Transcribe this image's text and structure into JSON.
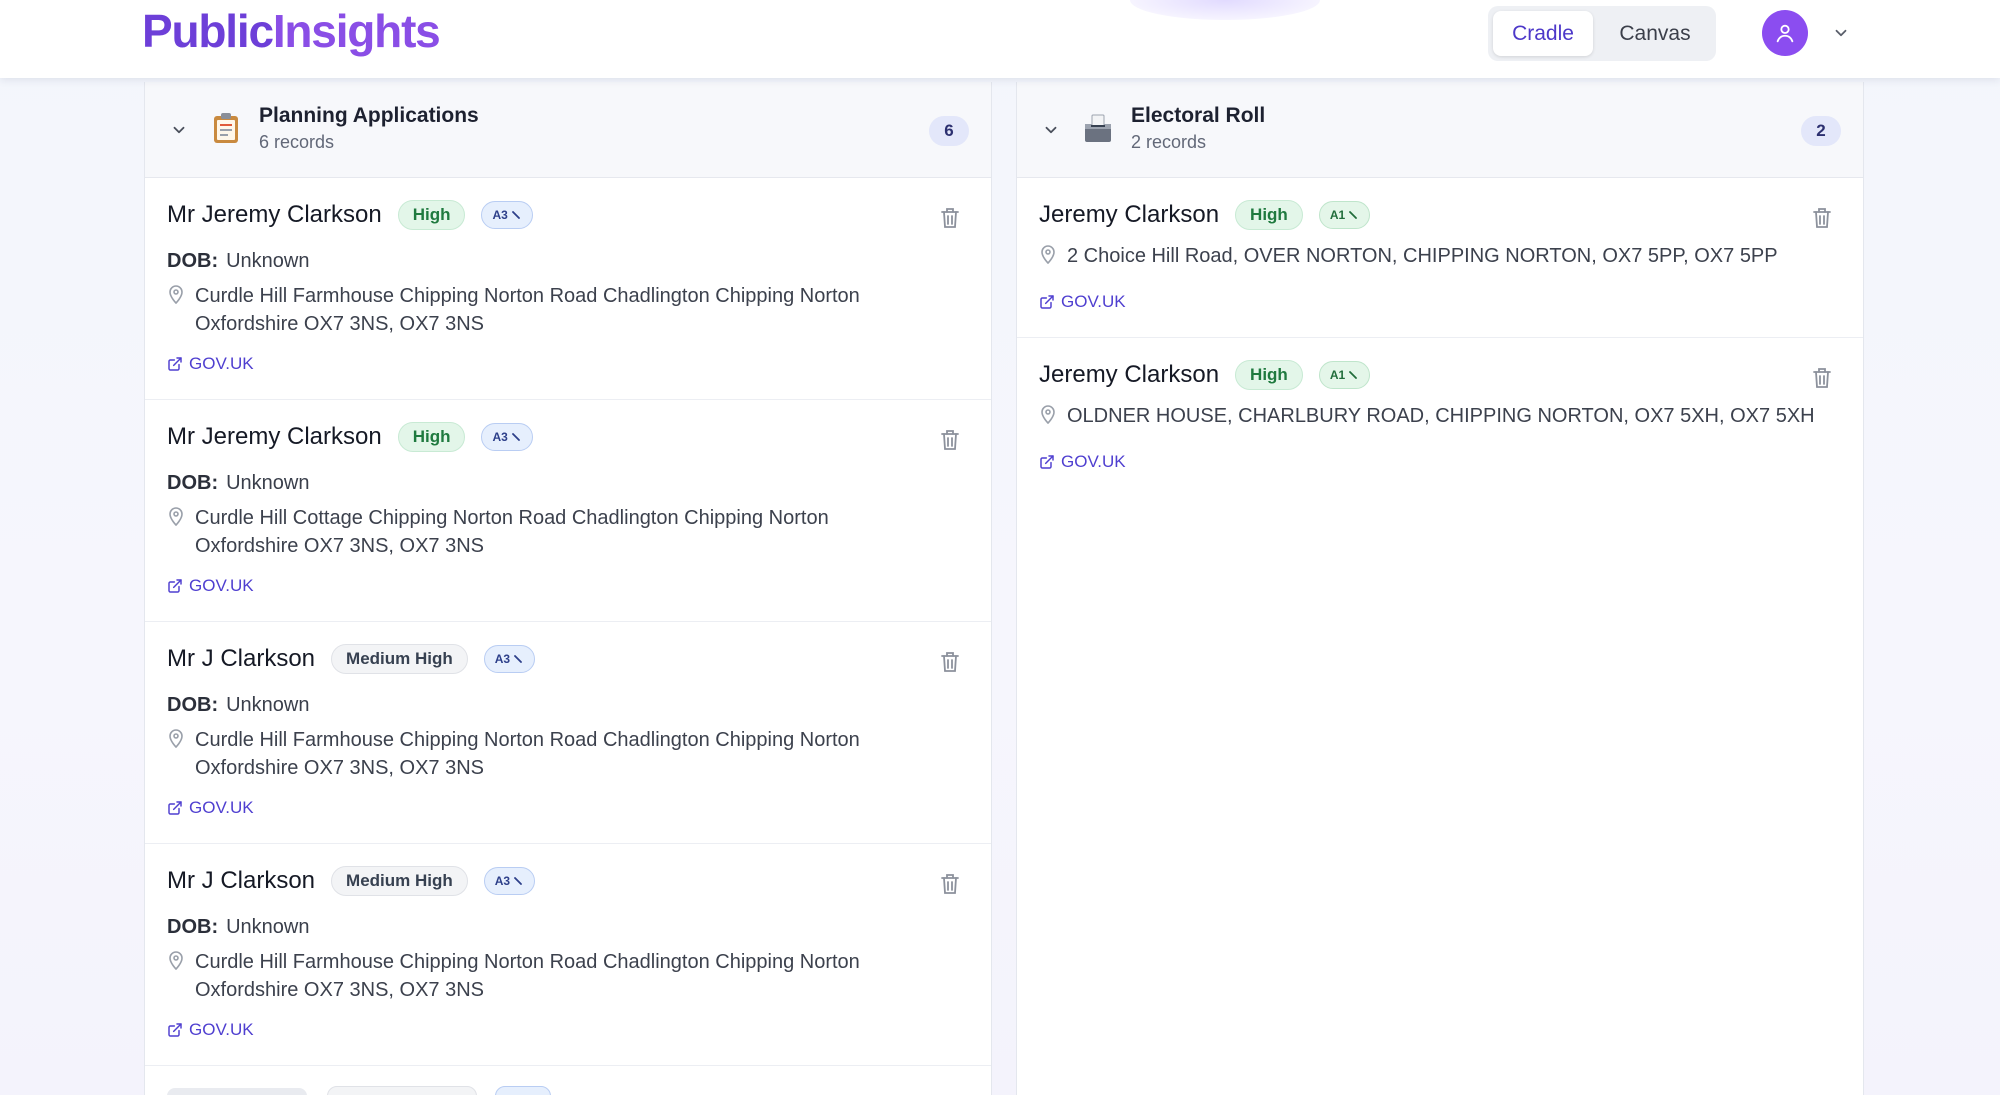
{
  "header": {
    "logo_part1": "Public",
    "logo_part2": "Insights",
    "views": [
      {
        "label": "Cradle",
        "active": true
      },
      {
        "label": "Canvas",
        "active": false
      }
    ],
    "avatar_icon": "user-icon",
    "menu_icon": "chevron-down-icon"
  },
  "colors": {
    "brand": "#6d3fd8",
    "accent": "#4f3fd0",
    "high_badge": "#1f7a3f"
  },
  "left_panel": {
    "title": "Planning Applications",
    "subtitle": "6 records",
    "count": "6",
    "icon": "clipboard-icon",
    "records": [
      {
        "name": "Mr Jeremy Clarkson",
        "confidence": "High",
        "tag": "A3",
        "dob_label": "DOB:",
        "dob": "Unknown",
        "address": "Curdle Hill Farmhouse Chipping Norton Road Chadlington Chipping Norton Oxfordshire OX7 3NS, OX7 3NS",
        "link": "GOV.UK"
      },
      {
        "name": "Mr Jeremy Clarkson",
        "confidence": "High",
        "tag": "A3",
        "dob_label": "DOB:",
        "dob": "Unknown",
        "address": "Curdle Hill Cottage Chipping Norton Road Chadlington Chipping Norton Oxfordshire OX7 3NS, OX7 3NS",
        "link": "GOV.UK"
      },
      {
        "name": "Mr J Clarkson",
        "confidence": "Medium High",
        "tag": "A3",
        "dob_label": "DOB:",
        "dob": "Unknown",
        "address": "Curdle Hill Farmhouse Chipping Norton Road Chadlington Chipping Norton Oxfordshire OX7 3NS, OX7 3NS",
        "link": "GOV.UK"
      },
      {
        "name": "Mr J Clarkson",
        "confidence": "Medium High",
        "tag": "A3",
        "dob_label": "DOB:",
        "dob": "Unknown",
        "address": "Curdle Hill Farmhouse Chipping Norton Road Chadlington Chipping Norton Oxfordshire OX7 3NS, OX7 3NS",
        "link": "GOV.UK"
      }
    ]
  },
  "right_panel": {
    "title": "Electoral Roll",
    "subtitle": "2 records",
    "count": "2",
    "icon": "ballot-box-icon",
    "records": [
      {
        "name": "Jeremy Clarkson",
        "confidence": "High",
        "tag": "A1",
        "address": "2 Choice Hill Road, OVER NORTON, CHIPPING NORTON, OX7 5PP, OX7 5PP",
        "link": "GOV.UK"
      },
      {
        "name": "Jeremy Clarkson",
        "confidence": "High",
        "tag": "A1",
        "address": "OLDNER HOUSE, CHARLBURY ROAD, CHIPPING NORTON, OX7 5XH, OX7 5XH",
        "link": "GOV.UK"
      }
    ]
  }
}
